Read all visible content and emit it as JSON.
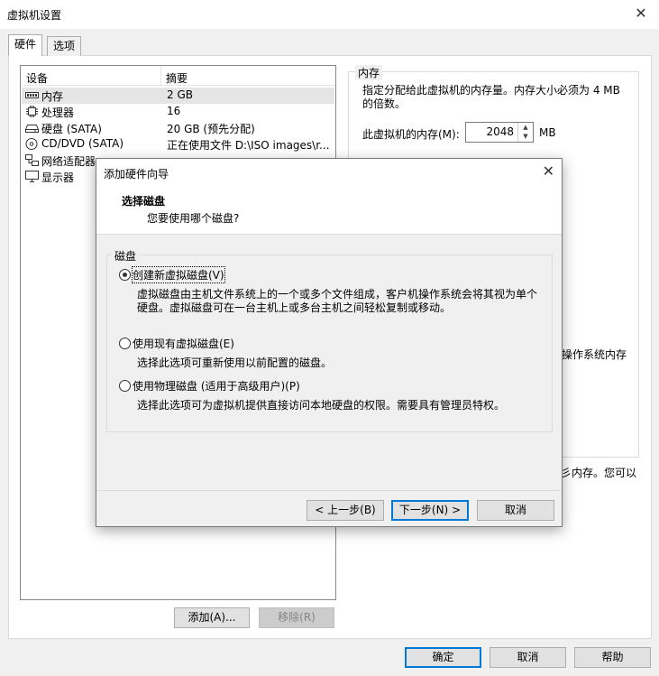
{
  "window": {
    "title": "虚拟机设置"
  },
  "tabs": [
    {
      "label": "硬件",
      "active": true
    },
    {
      "label": "选项",
      "active": false
    }
  ],
  "device_table": {
    "headers": [
      "设备",
      "摘要"
    ],
    "rows": [
      {
        "icon": "memory-icon",
        "name": "内存",
        "summary": "2 GB",
        "selected": true
      },
      {
        "icon": "cpu-icon",
        "name": "处理器",
        "summary": "16"
      },
      {
        "icon": "disk-icon",
        "name": "硬盘 (SATA)",
        "summary": "20 GB (预先分配)"
      },
      {
        "icon": "cd-icon",
        "name": "CD/DVD (SATA)",
        "summary": "正在使用文件 D:\\ISO images\\r..."
      },
      {
        "icon": "network-icon",
        "name": "网络适配器",
        "summary": ""
      },
      {
        "icon": "display-icon",
        "name": "显示器",
        "summary": ""
      }
    ]
  },
  "device_buttons": {
    "add": "添加(A)...",
    "remove": "移除(R)"
  },
  "memory": {
    "group_title": "内存",
    "description": "指定分配给此虚拟机的内存量。内存大小必须为 4 MB 的倍数。",
    "label": "此虚拟机的内存(M):",
    "value": "2048",
    "unit": "MB",
    "fragment_1": "操作系统内存",
    "fragment_2": "彡内存。您可以"
  },
  "footer": {
    "ok": "确定",
    "cancel": "取消",
    "help": "帮助"
  },
  "wizard": {
    "title": "添加硬件向导",
    "heading": "选择磁盘",
    "subheading": "您要使用哪个磁盘?",
    "group_title": "磁盘",
    "options": [
      {
        "label": "创建新虚拟磁盘(V)",
        "description": "虚拟磁盘由主机文件系统上的一个或多个文件组成，客户机操作系统会将其视为单个硬盘。虚拟磁盘可在一台主机上或多台主机之间轻松复制或移动。",
        "checked": true
      },
      {
        "label": "使用现有虚拟磁盘(E)",
        "description": "选择此选项可重新使用以前配置的磁盘。",
        "checked": false
      },
      {
        "label": "使用物理磁盘 (适用于高级用户)(P)",
        "description": "选择此选项可为虚拟机提供直接访问本地硬盘的权限。需要具有管理员特权。",
        "checked": false
      }
    ],
    "buttons": {
      "back": "< 上一步(B)",
      "next": "下一步(N) >",
      "cancel": "取消"
    }
  }
}
